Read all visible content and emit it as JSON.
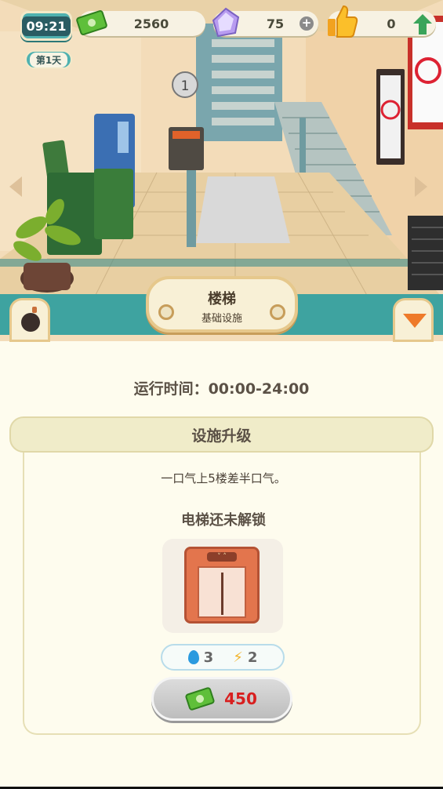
{
  "hud": {
    "time": "09:21",
    "day": "第1天",
    "money": "2560",
    "gems": "75",
    "likes": "0"
  },
  "scene": {
    "room_number": "1"
  },
  "facility": {
    "name": "楼梯",
    "category": "基础设施"
  },
  "panel": {
    "operating_hours": "运行时间：00:00-24:00",
    "upgrade_title": "设施升级",
    "description": "一口气上5楼差半口气。",
    "locked_text": "电梯还未解锁",
    "requirements": {
      "water": "3",
      "energy": "2"
    },
    "price": "450"
  },
  "colors": {
    "teal": "#3ea3a0",
    "panel_bg": "#fefcee",
    "price_red": "#d81f1f"
  }
}
